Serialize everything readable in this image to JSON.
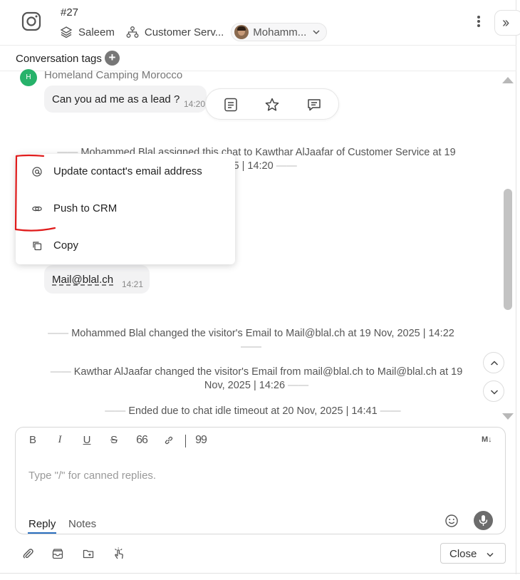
{
  "header": {
    "conversation_id": "#27",
    "inbox": "Saleem",
    "team": "Customer Serv...",
    "agent": "Mohamm..."
  },
  "tags": {
    "label": "Conversation tags",
    "add_symbol": "+"
  },
  "messages": {
    "sender_initial": "H",
    "sender_name": "Homeland Camping Morocco",
    "msg1_text": "Can you ad me as a lead ?",
    "msg1_time": "14:20",
    "msg2_text": "Mail@blal.ch",
    "msg2_time": "14:21"
  },
  "system_events": {
    "assign_line1": "Mohammed Blal assigned this chat to Kawthar AlJaafar of Customer Service at 19",
    "assign_line2": "2025 | 14:20",
    "email_change_1": "Mohammed Blal changed the visitor's Email to Mail@blal.ch at 19 Nov, 2025 | 14:22",
    "email_change_2_line1": "Kawthar AlJaafar changed the visitor's Email from mail@blal.ch to Mail@blal.ch at 19",
    "email_change_2_line2": "Nov, 2025 | 14:26",
    "ended": "Ended due to chat idle timeout at 20 Nov, 2025 | 14:41"
  },
  "context_menu": {
    "items": [
      {
        "label": "Update contact's email address",
        "icon": "at-sign-icon"
      },
      {
        "label": "Push to CRM",
        "icon": "link-icon"
      },
      {
        "label": "Copy",
        "icon": "copy-icon"
      }
    ],
    "highlight_color": "#e01b1b"
  },
  "composer": {
    "placeholder": "Type \"/\" for canned replies.",
    "format_buttons": [
      "B",
      "I",
      "U",
      "S",
      "66",
      "link",
      "99"
    ],
    "markdown_label": "M↓",
    "tab_reply": "Reply",
    "tab_notes": "Notes",
    "active_tab_color": "#2a6fbf"
  },
  "footer": {
    "close_label": "Close"
  }
}
